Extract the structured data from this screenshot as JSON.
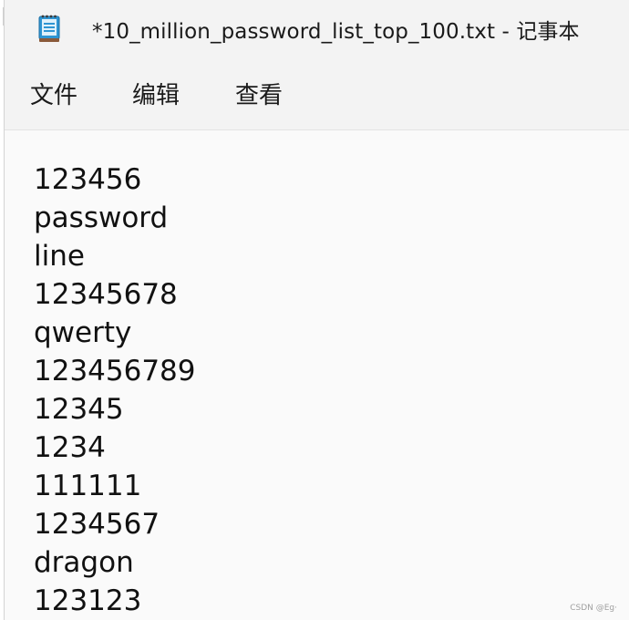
{
  "window": {
    "title": "*10_million_password_list_top_100.txt - 记事本",
    "icon": "notepad-icon"
  },
  "menubar": {
    "items": [
      {
        "label": "文件"
      },
      {
        "label": "编辑"
      },
      {
        "label": "查看"
      }
    ]
  },
  "editor": {
    "lines": [
      "123456",
      "password",
      "line",
      "12345678",
      "qwerty",
      "123456789",
      "12345",
      "1234",
      "111111",
      "1234567",
      "dragon",
      "123123"
    ]
  },
  "watermark": {
    "text": "CSDN @Eg·"
  },
  "colors": {
    "window_bg": "#f3f3f3",
    "editor_bg": "#fafafa",
    "text": "#111111",
    "icon_blue": "#1e88c8",
    "icon_brown": "#8a5a3a"
  }
}
